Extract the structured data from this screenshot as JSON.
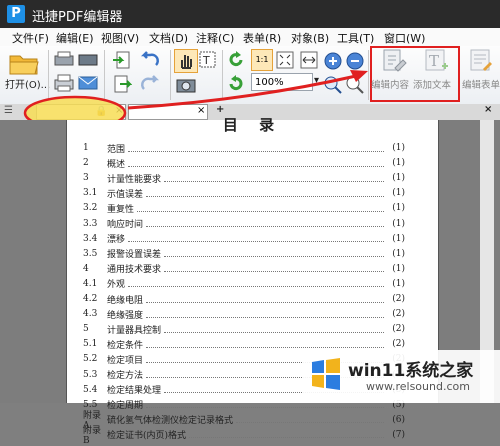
{
  "window": {
    "title": "迅捷PDF编辑器",
    "logo_letter": "P"
  },
  "menu": [
    "文件(F)",
    "编辑(E)",
    "视图(V)",
    "文档(D)",
    "注释(C)",
    "表单(R)",
    "对象(B)",
    "工具(T)",
    "窗口(W)"
  ],
  "toolbar": {
    "open_label": "打开(O)...",
    "zoom_value": "100%",
    "edit_content_label": "编辑内容",
    "add_text_label": "添加文本",
    "edit_form_label": "编辑表单",
    "fit_label": "1:1"
  },
  "tabs": {
    "new_tab_symbol": "+",
    "close_symbol": "×"
  },
  "document": {
    "heading": "目  录",
    "toc": [
      {
        "num": "1",
        "title": "范围",
        "page": "(1)"
      },
      {
        "num": "2",
        "title": "概述",
        "page": "(1)"
      },
      {
        "num": "3",
        "title": "计量性能要求",
        "page": "(1)"
      },
      {
        "num": "3.1",
        "title": "示值误差",
        "page": "(1)"
      },
      {
        "num": "3.2",
        "title": "重复性",
        "page": "(1)"
      },
      {
        "num": "3.3",
        "title": "响应时间",
        "page": "(1)"
      },
      {
        "num": "3.4",
        "title": "漂移",
        "page": "(1)"
      },
      {
        "num": "3.5",
        "title": "报警设置误差",
        "page": "(1)"
      },
      {
        "num": "4",
        "title": "通用技术要求",
        "page": "(1)"
      },
      {
        "num": "4.1",
        "title": "外观",
        "page": "(1)"
      },
      {
        "num": "4.2",
        "title": "绝缘电阻",
        "page": "(2)"
      },
      {
        "num": "4.3",
        "title": "绝缘强度",
        "page": "(2)"
      },
      {
        "num": "5",
        "title": "计量器具控制",
        "page": "(2)"
      },
      {
        "num": "5.1",
        "title": "检定条件",
        "page": "(2)"
      },
      {
        "num": "5.2",
        "title": "检定项目",
        "page": "(2)"
      },
      {
        "num": "5.3",
        "title": "检定方法",
        "page": "(2)"
      },
      {
        "num": "5.4",
        "title": "检定结果处理",
        "page": "(5)"
      },
      {
        "num": "5.5",
        "title": "检定周期",
        "page": "(5)"
      },
      {
        "num": "附录A",
        "title": "硫化氢气体检测仪检定记录格式",
        "page": "(6)"
      },
      {
        "num": "附录B",
        "title": "检定证书(内页)格式",
        "page": "(7)"
      }
    ]
  },
  "watermark": {
    "brand": "win11系统之家",
    "url": "www.relsound.com"
  },
  "colors": {
    "annotation_red": "#e02020",
    "highlight_yellow": "#f7dd55",
    "title_bg": "#2a2a2a"
  }
}
